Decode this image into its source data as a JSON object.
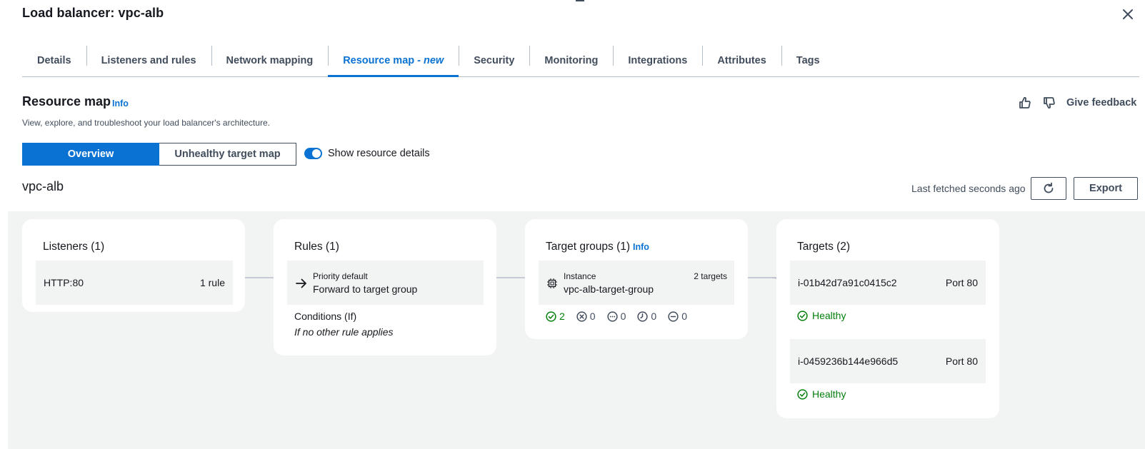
{
  "header": {
    "title": "Load balancer: vpc-alb",
    "close_icon": "close-icon"
  },
  "tabs": [
    {
      "label": "Details"
    },
    {
      "label": "Listeners and rules"
    },
    {
      "label": "Network mapping"
    },
    {
      "label": "Resource map",
      "suffix": "- new",
      "active": true
    },
    {
      "label": "Security"
    },
    {
      "label": "Monitoring"
    },
    {
      "label": "Integrations"
    },
    {
      "label": "Attributes"
    },
    {
      "label": "Tags"
    }
  ],
  "resource_map": {
    "title": "Resource map",
    "info": "Info",
    "description": "View, explore, and troubleshoot your load balancer's architecture.",
    "feedback_label": "Give feedback",
    "view_overview": "Overview",
    "view_unhealthy": "Unhealthy target map",
    "toggle_label": "Show resource details",
    "toggle_on": true,
    "lb_name": "vpc-alb",
    "last_fetched": "Last fetched seconds ago",
    "export_label": "Export"
  },
  "listeners": {
    "title": "Listeners (1)",
    "items": [
      {
        "name": "HTTP:80",
        "rules": "1 rule"
      }
    ]
  },
  "rules": {
    "title": "Rules (1)",
    "items": [
      {
        "priority": "Priority default",
        "action": "Forward to target group"
      }
    ],
    "conditions_title": "Conditions (If)",
    "conditions_value": "If no other rule applies"
  },
  "target_groups": {
    "title": "Target groups (1)",
    "info": "Info",
    "items": [
      {
        "type": "Instance",
        "name": "vpc-alb-target-group",
        "targets": "2 targets"
      }
    ],
    "counts": {
      "healthy": "2",
      "unhealthy": "0",
      "unused": "0",
      "initial": "0",
      "draining": "0"
    }
  },
  "targets": {
    "title": "Targets (2)",
    "items": [
      {
        "id": "i-01b42d7a91c0415c2",
        "port": "Port 80",
        "status": "Healthy"
      },
      {
        "id": "i-0459236b144e966d5",
        "port": "Port 80",
        "status": "Healthy"
      }
    ]
  },
  "colors": {
    "accent": "#0972d3",
    "healthy": "#037f0c",
    "text": "#16191f",
    "muted": "#414d5c",
    "canvas_bg": "#f2f3f3"
  }
}
